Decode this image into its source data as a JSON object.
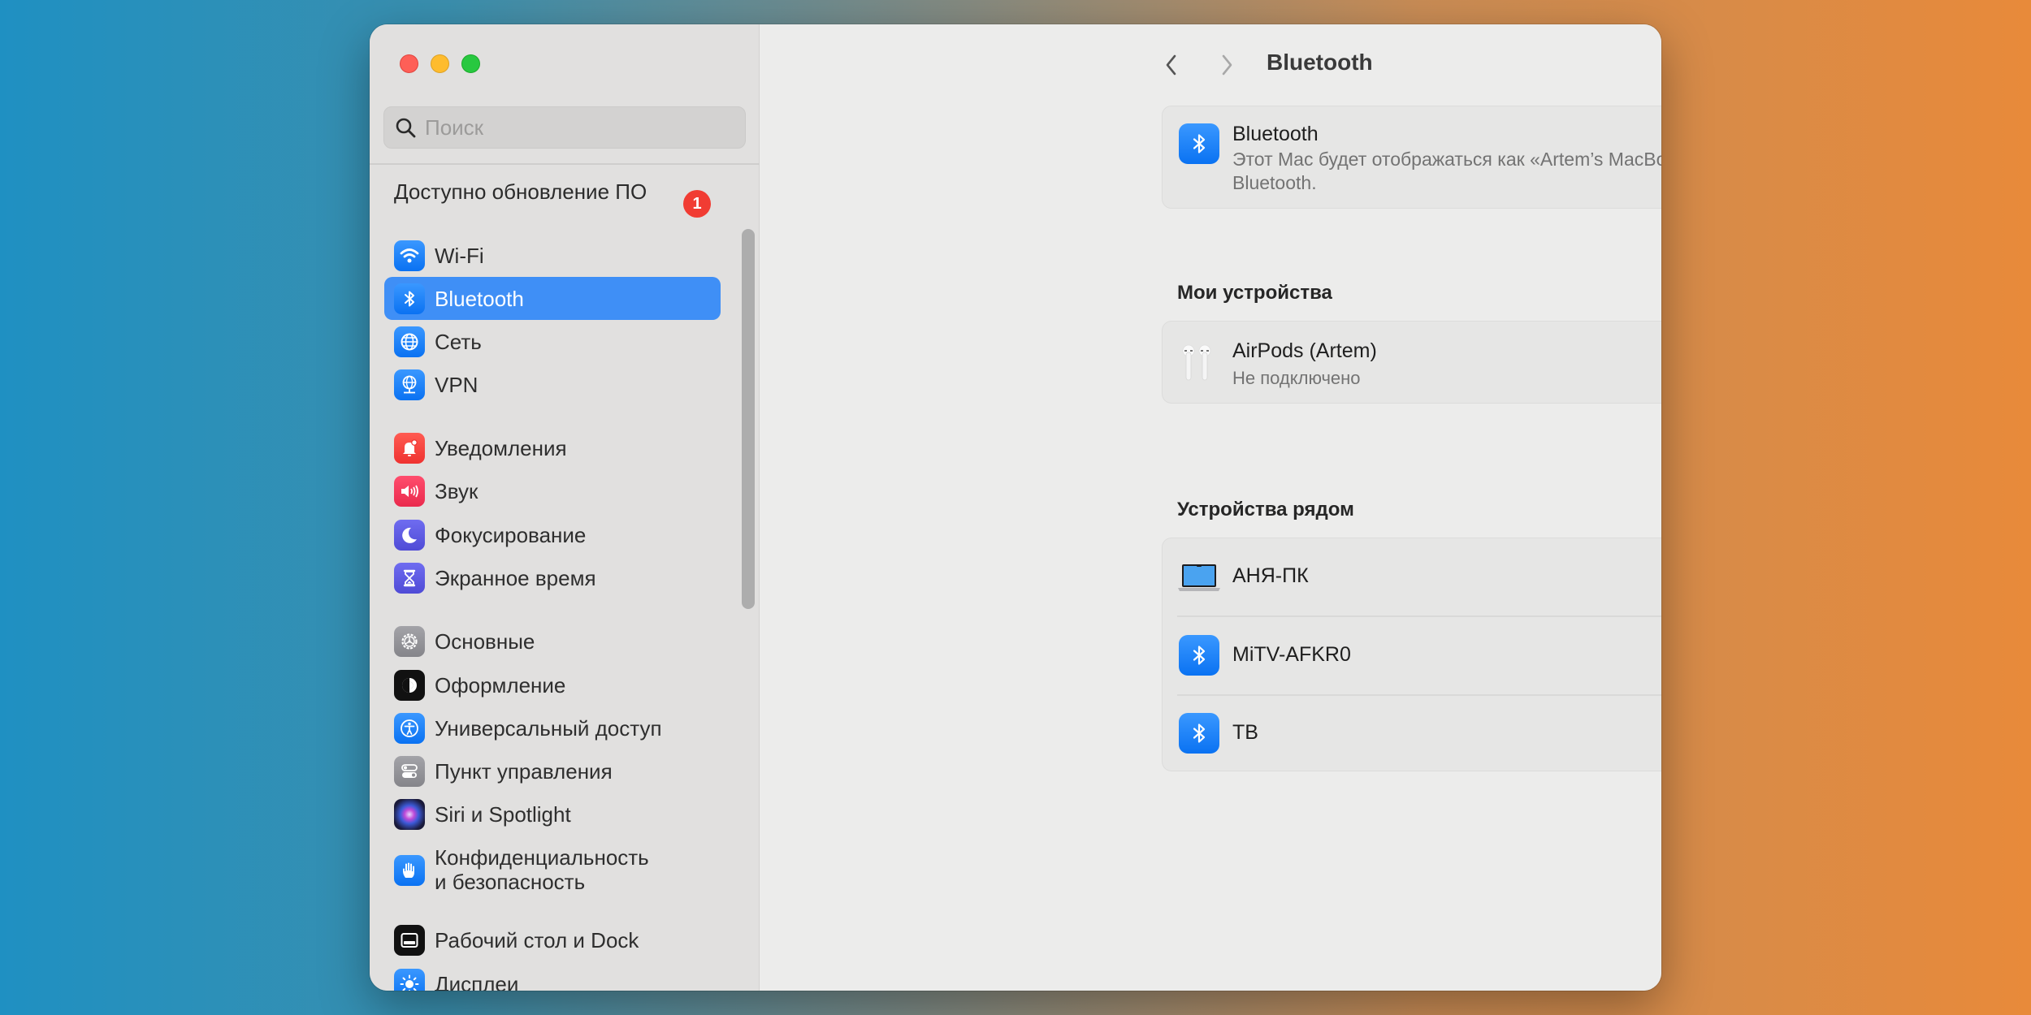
{
  "window": {
    "traffic_lights": [
      "close",
      "minimize",
      "maximize"
    ]
  },
  "sidebar": {
    "search": {
      "placeholder": "Поиск",
      "value": ""
    },
    "update": {
      "label": "Доступно обновление ПО",
      "badge": "1"
    },
    "items": [
      {
        "id": "wifi",
        "label": "Wi-Fi",
        "icon": "wifi-icon",
        "color": "#1f7ff5",
        "selected": false
      },
      {
        "id": "bluetooth",
        "label": "Bluetooth",
        "icon": "bluetooth-icon",
        "color": "#1f7ff5",
        "selected": true
      },
      {
        "id": "network",
        "label": "Сеть",
        "icon": "globe-icon",
        "color": "#1f7ff5",
        "selected": false
      },
      {
        "id": "vpn",
        "label": "VPN",
        "icon": "vpn-globe-icon",
        "color": "#1f7ff5",
        "selected": false
      },
      {
        "id": "notifications",
        "label": "Уведомления",
        "icon": "bell-icon",
        "color": "#f5433f",
        "selected": false
      },
      {
        "id": "sound",
        "label": "Звук",
        "icon": "speaker-icon",
        "color": "#f43c5c",
        "selected": false
      },
      {
        "id": "focus",
        "label": "Фокусирование",
        "icon": "moon-icon",
        "color": "#5b58dc",
        "selected": false
      },
      {
        "id": "screen-time",
        "label": "Экранное время",
        "icon": "hourglass-icon",
        "color": "#5b58dc",
        "selected": false
      },
      {
        "id": "general",
        "label": "Основные",
        "icon": "gear-icon",
        "color": "#8e8e93",
        "selected": false
      },
      {
        "id": "appearance",
        "label": "Оформление",
        "icon": "appearance-icon",
        "color": "#111111",
        "selected": false
      },
      {
        "id": "accessibility",
        "label": "Универсальный доступ",
        "icon": "accessibility-icon",
        "color": "#1a7ff5",
        "selected": false
      },
      {
        "id": "control-center",
        "label": "Пункт управления",
        "icon": "switches-icon",
        "color": "#8e8e93",
        "selected": false
      },
      {
        "id": "siri",
        "label": "Siri и Spotlight",
        "icon": "siri-icon",
        "color": "#2a1a3a",
        "selected": false
      },
      {
        "id": "privacy",
        "label": "Конфиденциальность\nи безопасность",
        "line1": "Конфиденциальность",
        "line2": "и безопасность",
        "icon": "hand-icon",
        "color": "#1a7ff5",
        "selected": false
      },
      {
        "id": "desktop-dock",
        "label": "Рабочий стол и Dock",
        "icon": "dock-icon",
        "color": "#111111",
        "selected": false
      },
      {
        "id": "displays",
        "label": "Дисплеи",
        "icon": "sun-icon",
        "color": "#1a7ff5",
        "selected": false
      }
    ]
  },
  "header": {
    "title": "Bluetooth",
    "back_label": "Назад",
    "forward_label": "Вперед"
  },
  "bluetooth_card": {
    "title": "Bluetooth",
    "description_line1": "Этот Mac будет отображаться как «Artem’s MacBook Pro» в настройках",
    "description_line2": "Bluetooth.",
    "enabled": true
  },
  "my_devices": {
    "title": "Мои устройства",
    "devices": [
      {
        "name": "AirPods (Artem)",
        "status": "Не подключено",
        "icon": "airpods-icon"
      }
    ]
  },
  "help_label": "?",
  "nearby": {
    "title": "Устройства рядом",
    "loading": true,
    "devices": [
      {
        "name": "АНЯ-ПК",
        "icon": "laptop-icon"
      },
      {
        "name": "MiTV-AFKR0",
        "icon": "bluetooth-icon"
      },
      {
        "name": "ТВ",
        "icon": "bluetooth-icon"
      }
    ]
  },
  "colors": {
    "accent": "#3f8ff6",
    "toggle_on": "#1a7ff5",
    "badge": "#f13c33",
    "highlight_box": "#f51b07"
  }
}
